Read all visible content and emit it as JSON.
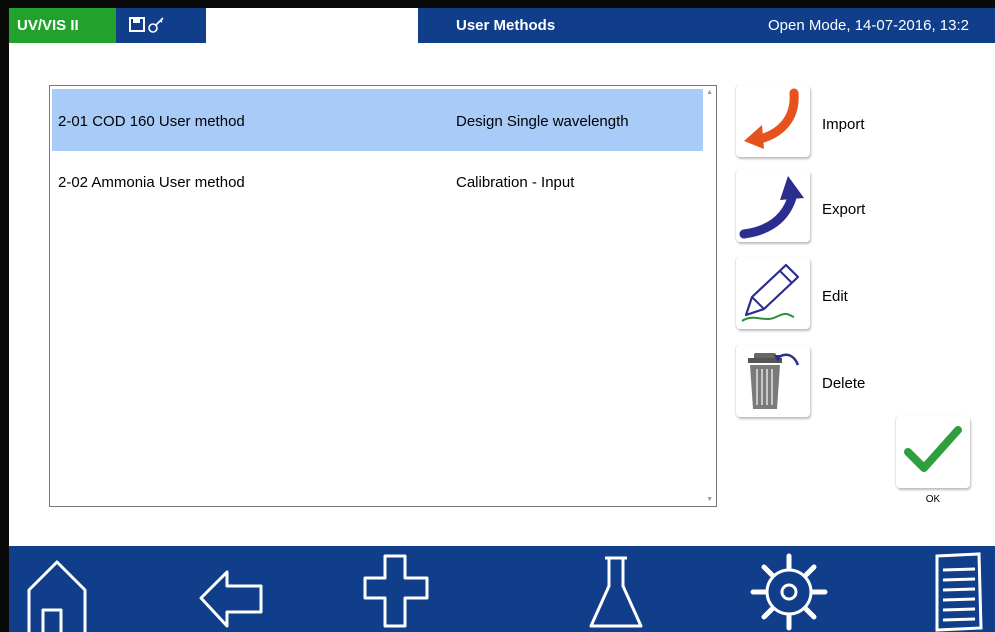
{
  "header": {
    "brand": "UV/VIS II",
    "title": "User Methods",
    "status": "Open Mode, 14-07-2016, 13:2"
  },
  "methods": [
    {
      "name": "2-01 COD 160 User method",
      "type": "Design Single wavelength",
      "selected": true
    },
    {
      "name": "2-02 Ammonia User method",
      "type": "Calibration - Input",
      "selected": false
    }
  ],
  "actions": {
    "import": "Import",
    "export": "Export",
    "edit": "Edit",
    "delete": "Delete",
    "ok": "OK"
  },
  "icons": {
    "header": [
      "save-icon",
      "key-icon"
    ],
    "side": [
      "import-arrow-icon",
      "export-arrow-icon",
      "pencil-icon",
      "trash-icon",
      "checkmark-icon"
    ],
    "nav": [
      "home-icon",
      "back-arrow-icon",
      "plus-icon",
      "flask-icon",
      "gear-icon",
      "menu-list-icon"
    ]
  },
  "colors": {
    "brand_green": "#21a32b",
    "header_blue": "#103e8a",
    "selection_blue": "#a9cbf7",
    "import_orange": "#e5521e",
    "export_navy": "#2b2e8f",
    "ok_green": "#2e9e3f"
  }
}
